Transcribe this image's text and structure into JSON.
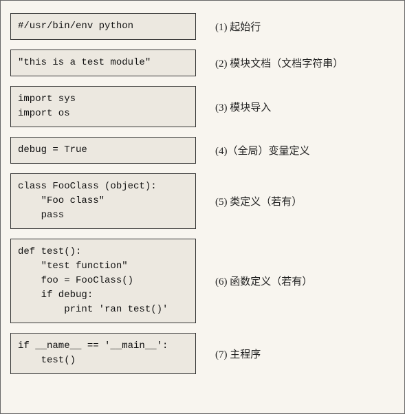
{
  "sections": [
    {
      "code": "#/usr/bin/env python",
      "label": "(1) 起始行"
    },
    {
      "code": "\"this is a test module\"",
      "label": "(2) 模块文档（文档字符串）"
    },
    {
      "code": "import sys\nimport os",
      "label": "(3) 模块导入"
    },
    {
      "code": "debug = True",
      "label": "(4)（全局）变量定义"
    },
    {
      "code": "class FooClass (object):\n    \"Foo class\"\n    pass",
      "label": "(5) 类定义（若有）"
    },
    {
      "code": "def test():\n    \"test function\"\n    foo = FooClass()\n    if debug:\n        print 'ran test()'",
      "label": "(6) 函数定义（若有）"
    },
    {
      "code": "if __name__ == '__main__':\n    test()",
      "label": "(7) 主程序"
    }
  ]
}
